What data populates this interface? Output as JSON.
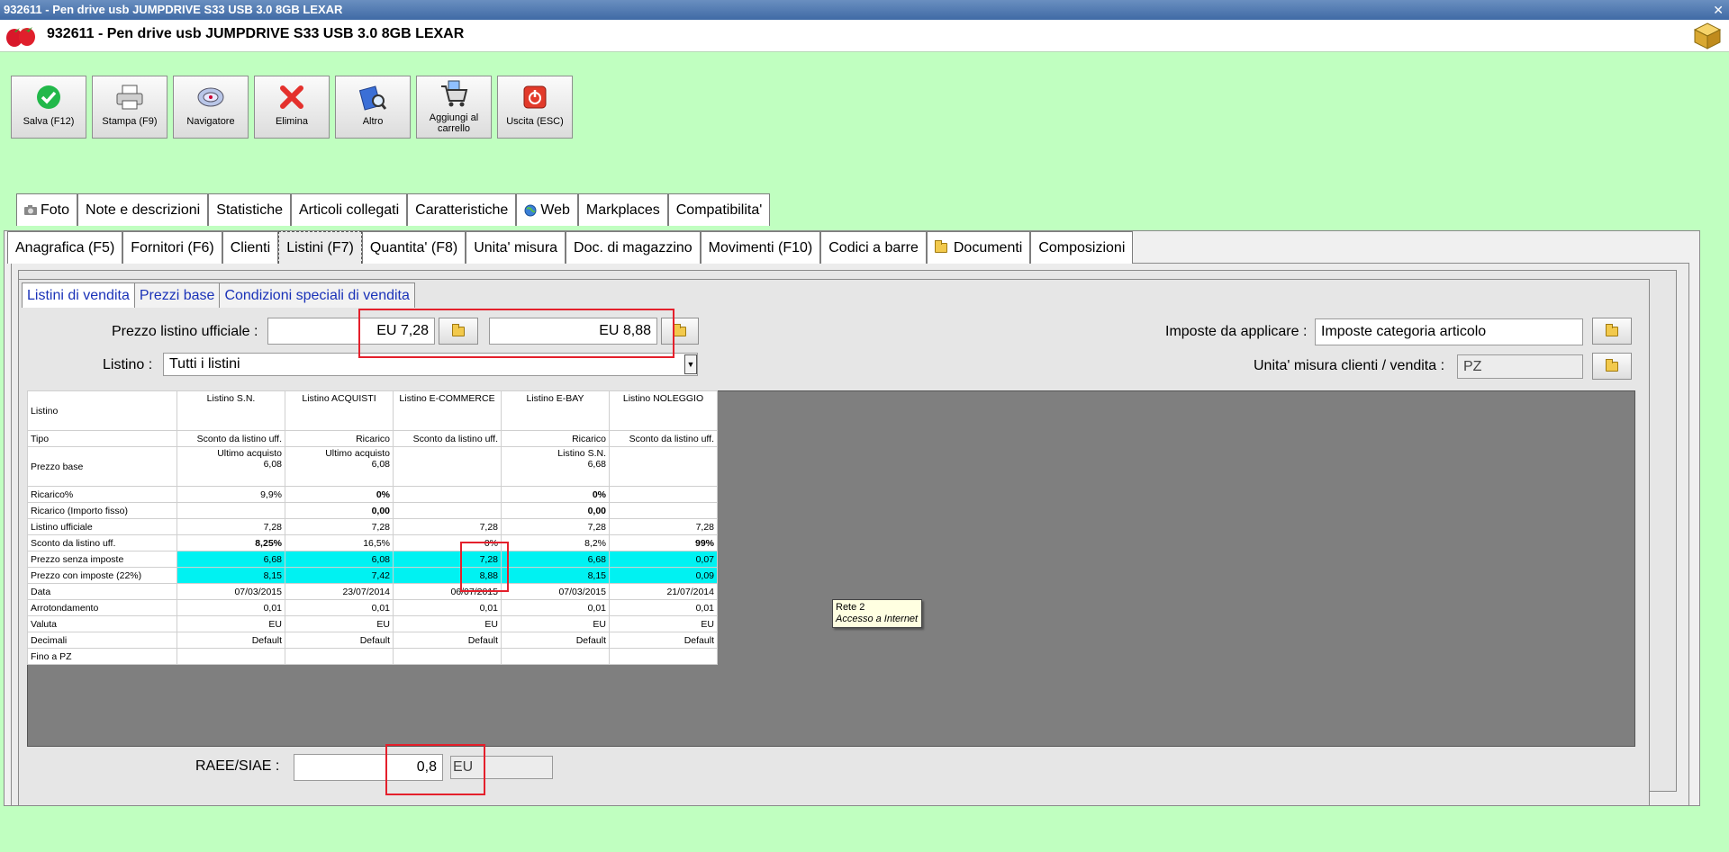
{
  "window": {
    "title": "932611 - Pen drive usb JUMPDRIVE S33 USB 3.0 8GB LEXAR",
    "close": "✕"
  },
  "header": {
    "title": "932611 - Pen drive usb JUMPDRIVE S33 USB 3.0 8GB LEXAR"
  },
  "toolbar": [
    {
      "label": "Salva (F12)",
      "icon": "check-icon"
    },
    {
      "label": "Stampa (F9)",
      "icon": "printer-icon"
    },
    {
      "label": "Navigatore",
      "icon": "navigator-icon"
    },
    {
      "label": "Elimina",
      "icon": "delete-x-icon"
    },
    {
      "label": "Altro",
      "icon": "book-search-icon"
    },
    {
      "label": "Aggiungi al carrello",
      "icon": "cart-icon"
    },
    {
      "label": "Uscita (ESC)",
      "icon": "exit-icon"
    }
  ],
  "tabs_top": [
    "Foto",
    "Note e descrizioni",
    "Statistiche",
    "Articoli collegati",
    "Caratteristiche",
    "Web",
    "Markplaces",
    "Compatibilita'"
  ],
  "tabs_main": [
    "Anagrafica (F5)",
    "Fornitori (F6)",
    "Clienti",
    "Listini (F7)",
    "Quantita' (F8)",
    "Unita' misura",
    "Doc. di magazzino",
    "Movimenti (F10)",
    "Codici a barre",
    "Documenti",
    "Composizioni"
  ],
  "subtabs": [
    "Listini di vendita",
    "Prezzi base",
    "Condizioni speciali di vendita"
  ],
  "form": {
    "prezzo_label": "Prezzo listino ufficiale :",
    "prezzo_value": "EU 7,28",
    "prezzo_ivato": "EU 8,88",
    "listino_label": "Listino :",
    "listino_value": "Tutti i listini",
    "imposte_label": "Imposte da applicare :",
    "imposte_value": "Imposte categoria articolo",
    "unita_label": "Unita' misura clienti / vendita :",
    "unita_value": "PZ",
    "raee_label": "RAEE/SIAE :",
    "raee_value": "0,8",
    "raee_currency": "EU"
  },
  "table": {
    "columns": [
      "Listino S.N.",
      "Listino ACQUISTI",
      "Listino E-COMMERCE",
      "Listino E-BAY",
      "Listino NOLEGGIO"
    ],
    "header_label": "Listino",
    "rows": [
      {
        "label": "Tipo",
        "cells": [
          "Sconto da listino uff.",
          "Ricarico",
          "Sconto da listino uff.",
          "Ricarico",
          "Sconto da listino uff."
        ]
      },
      {
        "label": "Prezzo base",
        "cells": [
          "Ultimo acquisto\n6,08",
          "Ultimo acquisto\n6,08",
          "",
          "Listino S.N.\n6,68",
          ""
        ]
      },
      {
        "label": "Ricarico%",
        "cells": [
          "9,9%",
          "0%",
          "",
          "0%",
          ""
        ]
      },
      {
        "label": "Ricarico (Importo fisso)",
        "cells": [
          "",
          "0,00",
          "",
          "0,00",
          ""
        ]
      },
      {
        "label": "Listino ufficiale",
        "cells": [
          "7,28",
          "7,28",
          "7,28",
          "7,28",
          "7,28"
        ]
      },
      {
        "label": "Sconto da listino uff.",
        "cells": [
          "8,25%",
          "16,5%",
          "0%",
          "8,2%",
          "99%"
        ]
      },
      {
        "label": "Prezzo senza imposte",
        "cells": [
          "6,68",
          "6,08",
          "7,28",
          "6,68",
          "0,07"
        ]
      },
      {
        "label": "Prezzo con imposte (22%)",
        "cells": [
          "8,15",
          "7,42",
          "8,88",
          "8,15",
          "0,09"
        ]
      },
      {
        "label": "Data",
        "cells": [
          "07/03/2015",
          "23/07/2014",
          "06/07/2015",
          "07/03/2015",
          "21/07/2014"
        ]
      },
      {
        "label": "Arrotondamento",
        "cells": [
          "0,01",
          "0,01",
          "0,01",
          "0,01",
          "0,01"
        ]
      },
      {
        "label": "Valuta",
        "cells": [
          "EU",
          "EU",
          "EU",
          "EU",
          "EU"
        ]
      },
      {
        "label": "Decimali",
        "cells": [
          "Default",
          "Default",
          "Default",
          "Default",
          "Default"
        ]
      },
      {
        "label": "Fino a PZ",
        "cells": [
          "",
          "",
          "",
          "",
          ""
        ]
      }
    ]
  },
  "tooltip": {
    "line1": "Rete  2",
    "line2": "Accesso a Internet"
  },
  "colors": {
    "background": "#c0ffc0",
    "highlight_cyan": "#00f2f2",
    "annotation_red": "#e4202c",
    "link_blue": "#1a32b8"
  }
}
